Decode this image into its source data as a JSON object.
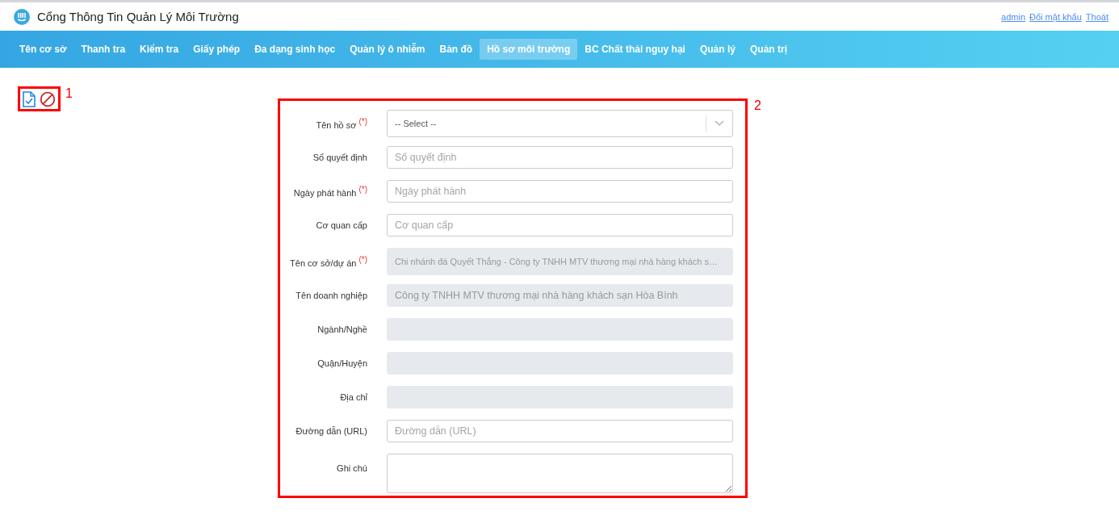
{
  "header": {
    "title": "Cổng Thông Tin Quản Lý Môi Trường",
    "links": [
      "admin",
      "Đổi mật khẩu",
      "Thoát"
    ]
  },
  "nav": [
    {
      "label": "Tên cơ sở",
      "selected": false
    },
    {
      "label": "Thanh tra",
      "selected": false
    },
    {
      "label": "Kiểm tra",
      "selected": false
    },
    {
      "label": "Giấy phép",
      "selected": false
    },
    {
      "label": "Đa dạng sinh học",
      "selected": false
    },
    {
      "label": "Quản lý ô nhiễm",
      "selected": false
    },
    {
      "label": "Bản đồ",
      "selected": false
    },
    {
      "label": "Hồ sơ môi trường",
      "selected": true
    },
    {
      "label": "BC Chất thải nguy hại",
      "selected": false
    },
    {
      "label": "Quản lý",
      "selected": false
    },
    {
      "label": "Quản trị",
      "selected": false
    }
  ],
  "annotations": [
    "1",
    "2"
  ],
  "form": [
    {
      "kind": "select",
      "label": "Tên hồ sơ",
      "required_mark": "(*)",
      "value": "-- Select --",
      "disabled": false
    },
    {
      "kind": "input",
      "label": "Số quyết định",
      "placeholder": "Số quyết định",
      "disabled": false
    },
    {
      "kind": "input",
      "label": "Ngày phát hành",
      "required_mark": "(*)",
      "placeholder": "Ngày phát hành",
      "disabled": false
    },
    {
      "kind": "input",
      "label": "Cơ quan cấp",
      "placeholder": "Cơ quan cấp",
      "disabled": false
    },
    {
      "kind": "select",
      "label": "Tên cơ sở/dự án",
      "required_mark": "(*)",
      "value": "Chi nhánh đá Quyết Thắng - Công ty TNHH MTV thương mại nhà hàng khách s…",
      "disabled": true
    },
    {
      "kind": "input",
      "label": "Tên doanh nghiệp",
      "value": "Công ty TNHH MTV thương mại nhà hàng khách sạn Hòa Bình",
      "disabled": true
    },
    {
      "kind": "input",
      "label": "Ngành/Nghề",
      "disabled": true
    },
    {
      "kind": "input",
      "label": "Quận/Huyện",
      "disabled": true
    },
    {
      "kind": "input",
      "label": "Địa chỉ",
      "disabled": true
    },
    {
      "kind": "input",
      "label": "Đường dẫn (URL)",
      "placeholder": "Đường dẫn (URL)",
      "disabled": false
    },
    {
      "kind": "textarea",
      "label": "Ghi chú",
      "disabled": false
    }
  ]
}
